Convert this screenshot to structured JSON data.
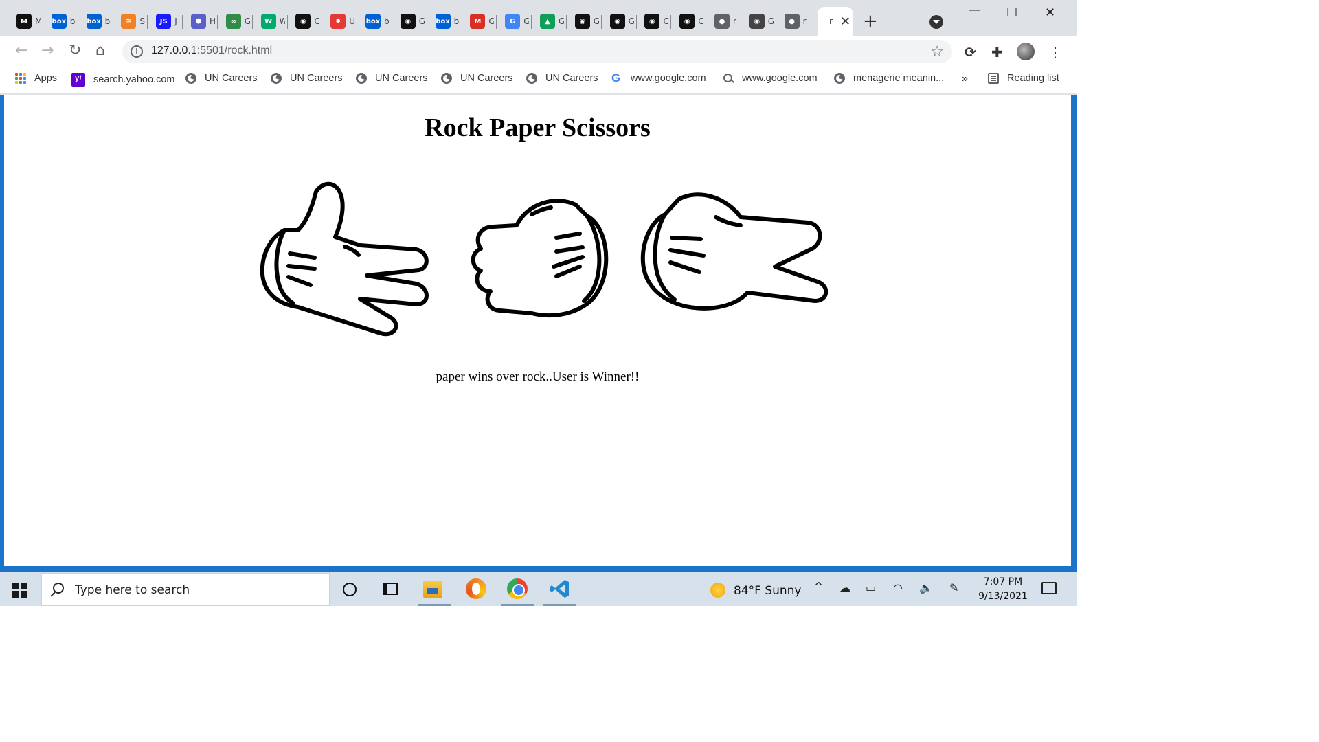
{
  "browser": {
    "tabs": [
      {
        "icon": "m-logo-icon",
        "title": "M",
        "color": "#111111",
        "glyph": "M"
      },
      {
        "icon": "box-icon",
        "title": "b",
        "color": "#0061d5",
        "glyph": "box"
      },
      {
        "icon": "box-icon",
        "title": "b",
        "color": "#0061d5",
        "glyph": "box"
      },
      {
        "icon": "stackoverflow-icon",
        "title": "S",
        "color": "#f48024",
        "glyph": "≋"
      },
      {
        "icon": "javascript-icon",
        "title": "J",
        "color": "#1a1aff",
        "glyph": "JS"
      },
      {
        "icon": "hexagon-icon",
        "title": "H",
        "color": "#5b5fc7",
        "glyph": "⬢"
      },
      {
        "icon": "geeksforgeeks-icon",
        "title": "G",
        "color": "#2f8d46",
        "glyph": "∞"
      },
      {
        "icon": "w3-icon",
        "title": "W",
        "color": "#04aa6d",
        "glyph": "W"
      },
      {
        "icon": "github-icon",
        "title": "G",
        "color": "#111111",
        "glyph": "◉"
      },
      {
        "icon": "gear-icon",
        "title": "U",
        "color": "#e53935",
        "glyph": "✹"
      },
      {
        "icon": "box-icon",
        "title": "b",
        "color": "#0061d5",
        "glyph": "box"
      },
      {
        "icon": "github-icon",
        "title": "G",
        "color": "#111111",
        "glyph": "◉"
      },
      {
        "icon": "box-icon",
        "title": "b",
        "color": "#0061d5",
        "glyph": "box"
      },
      {
        "icon": "gmail-icon",
        "title": "G",
        "color": "#d93025",
        "glyph": "M"
      },
      {
        "icon": "google-icon",
        "title": "G",
        "color": "#4285f4",
        "glyph": "G"
      },
      {
        "icon": "google-drive-icon",
        "title": "G",
        "color": "#0f9d58",
        "glyph": "▲"
      },
      {
        "icon": "github-icon",
        "title": "G",
        "color": "#111111",
        "glyph": "◉"
      },
      {
        "icon": "github-icon",
        "title": "G",
        "color": "#111111",
        "glyph": "◉"
      },
      {
        "icon": "github-icon",
        "title": "G",
        "color": "#111111",
        "glyph": "◉"
      },
      {
        "icon": "github-icon",
        "title": "G",
        "color": "#111111",
        "glyph": "◉"
      },
      {
        "icon": "globe-icon",
        "title": "r",
        "color": "#5f6368",
        "glyph": "●"
      },
      {
        "icon": "github-icon",
        "title": "G",
        "color": "#444444",
        "glyph": "◉"
      },
      {
        "icon": "globe-icon",
        "title": "r",
        "color": "#5f6368",
        "glyph": "●"
      }
    ],
    "active_tab": {
      "title": "r",
      "close": "✕"
    },
    "new_tab": "+",
    "window": {
      "minimize": "—",
      "maximize": "☐",
      "close": "✕"
    },
    "nav": {
      "back": "←",
      "forward": "→",
      "reload": "↻",
      "home": "⌂"
    },
    "address": {
      "host": "127.0.0.1",
      "path": ":5501/rock.html",
      "info": "i"
    },
    "toolbar": {
      "sync": "⟳",
      "extensions": "✚",
      "menu": "⋮"
    },
    "bookmarks": [
      {
        "label": "Apps",
        "icon": "apps-icon"
      },
      {
        "label": "search.yahoo.com",
        "icon": "yahoo-icon"
      },
      {
        "label": "UN Careers",
        "icon": "globe-icon"
      },
      {
        "label": "UN Careers",
        "icon": "globe-icon"
      },
      {
        "label": "UN Careers",
        "icon": "globe-icon"
      },
      {
        "label": "UN Careers",
        "icon": "globe-icon"
      },
      {
        "label": "UN Careers",
        "icon": "globe-icon"
      },
      {
        "label": "www.google.com",
        "icon": "google-icon"
      },
      {
        "label": "www.google.com",
        "icon": "search-icon"
      },
      {
        "label": "menagerie meanin...",
        "icon": "globe-icon"
      }
    ],
    "bookmarks_overflow": "»",
    "reading_list": "Reading list"
  },
  "page": {
    "title": "Rock Paper Scissors",
    "hands": [
      "paper",
      "rock",
      "scissors"
    ],
    "result": "paper wins over rock..User is Winner!!"
  },
  "taskbar": {
    "search_placeholder": "Type here to search",
    "weather": "84°F  Sunny",
    "time": "7:07 PM",
    "date": "9/13/2021",
    "tray": {
      "chevron": "^",
      "onedrive": "☁",
      "battery": "▭",
      "wifi": "◠",
      "volume": "🔈",
      "pen": "✎"
    }
  }
}
